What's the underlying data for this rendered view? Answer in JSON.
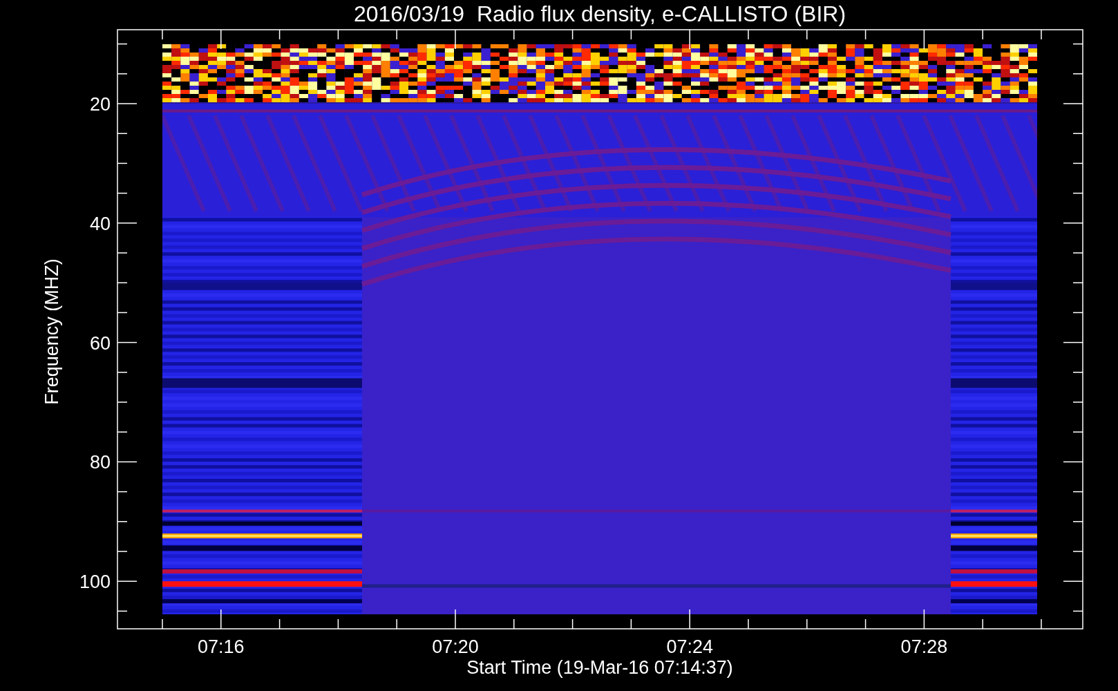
{
  "title": "2016/03/19  Radio flux density, e-CALLISTO (BIR)",
  "y_axis": {
    "label": "Frequency (MHZ)",
    "ticks": [
      "20",
      "40",
      "60",
      "80",
      "100"
    ]
  },
  "x_axis": {
    "label": "Start Time (19-Mar-16 07:14:37)",
    "ticks": [
      "07:16",
      "07:20",
      "07:24",
      "07:28"
    ]
  }
}
